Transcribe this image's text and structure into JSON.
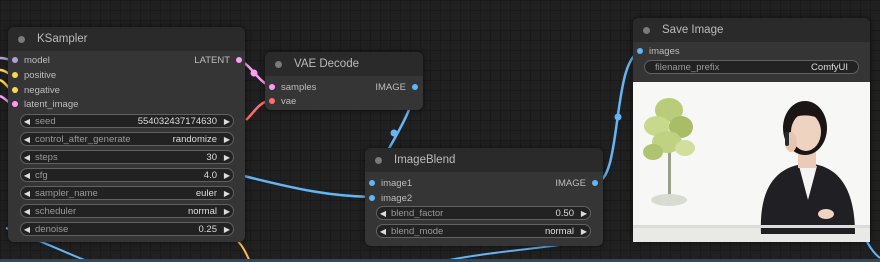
{
  "colors": {
    "model": "#b39ddb",
    "clip_yellow": "#ffd54f",
    "latent": "#ff9cf9",
    "vae": "#ff6e6e",
    "image": "#64b5f6"
  },
  "ksampler": {
    "title": "KSampler",
    "inputs": [
      "model",
      "positive",
      "negative",
      "latent_image"
    ],
    "output": "LATENT",
    "widgets": [
      {
        "label": "seed",
        "value": "554032437174630"
      },
      {
        "label": "control_after_generate",
        "value": "randomize"
      },
      {
        "label": "steps",
        "value": "30"
      },
      {
        "label": "cfg",
        "value": "4.0"
      },
      {
        "label": "sampler_name",
        "value": "euler"
      },
      {
        "label": "scheduler",
        "value": "normal"
      },
      {
        "label": "denoise",
        "value": "0.25"
      }
    ]
  },
  "vae_decode": {
    "title": "VAE Decode",
    "inputs": [
      "samples",
      "vae"
    ],
    "output": "IMAGE"
  },
  "image_blend": {
    "title": "ImageBlend",
    "inputs": [
      "image1",
      "image2"
    ],
    "output": "IMAGE",
    "widgets": [
      {
        "label": "blend_factor",
        "value": "0.50"
      },
      {
        "label": "blend_mode",
        "value": "normal"
      }
    ]
  },
  "save_image": {
    "title": "Save Image",
    "input": "images",
    "filename_prefix_label": "filename_prefix",
    "filename_prefix_value": "ComfyUI"
  }
}
